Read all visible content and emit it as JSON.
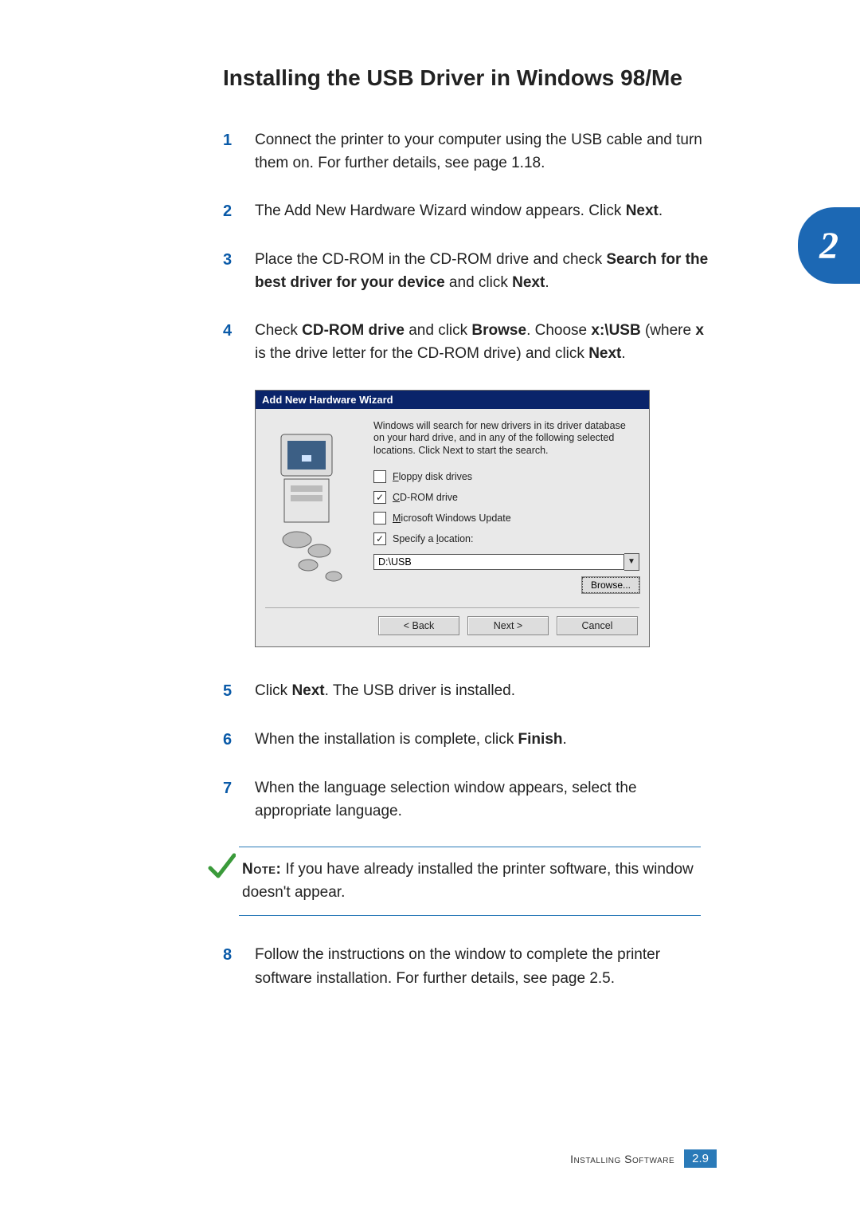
{
  "heading": "Installing the USB Driver in Windows 98/Me",
  "side_tab": "2",
  "steps": {
    "s1": {
      "num": "1",
      "text": "Connect the printer to your computer using the USB cable and turn them on. For further details, see page 1.18."
    },
    "s2": {
      "num": "2",
      "text_pre": "The Add New Hardware Wizard window appears. Click ",
      "bold": "Next",
      "text_post": "."
    },
    "s3": {
      "num": "3",
      "text_pre": "Place the CD-ROM in the CD-ROM drive and check ",
      "bold": "Search for the best driver for your device",
      "text_mid": " and click ",
      "bold2": "Next",
      "text_post": "."
    },
    "s4": {
      "num": "4",
      "text_pre": "Check ",
      "bold": "CD-ROM drive",
      "text_mid": " and click ",
      "bold2": "Browse",
      "text_mid2": ". Choose ",
      "bold3": "x:\\USB",
      "text_mid3": " (where ",
      "bold4": "x",
      "text_mid4": " is the drive letter for the CD-ROM drive) and click ",
      "bold5": "Next",
      "text_post": "."
    },
    "s5": {
      "num": "5",
      "text_pre": "Click ",
      "bold": "Next",
      "text_post": ". The USB driver is installed."
    },
    "s6": {
      "num": "6",
      "text_pre": "When the installation is complete, click ",
      "bold": "Finish",
      "text_post": "."
    },
    "s7": {
      "num": "7",
      "text": "When the language selection window appears, select the appropriate language."
    },
    "s8": {
      "num": "8",
      "text": "Follow the instructions on the window to complete the printer software installation. For further details, see page 2.5."
    }
  },
  "note": {
    "label": "Note:",
    "body": " If you have already installed the printer software, this window doesn't appear."
  },
  "dialog": {
    "title": "Add New Hardware Wizard",
    "desc": "Windows will search for new drivers in its driver database on your hard drive, and in any of the following selected locations. Click Next to start the search.",
    "floppy": "Floppy disk drives",
    "cdrom": "CD-ROM drive",
    "update": "Microsoft Windows Update",
    "specify": "Specify a location:",
    "path": "D:\\USB",
    "browse": "Browse...",
    "back": "< Back",
    "next": "Next >",
    "cancel": "Cancel"
  },
  "footer": {
    "section": "Installing Software",
    "page": "2.9"
  }
}
